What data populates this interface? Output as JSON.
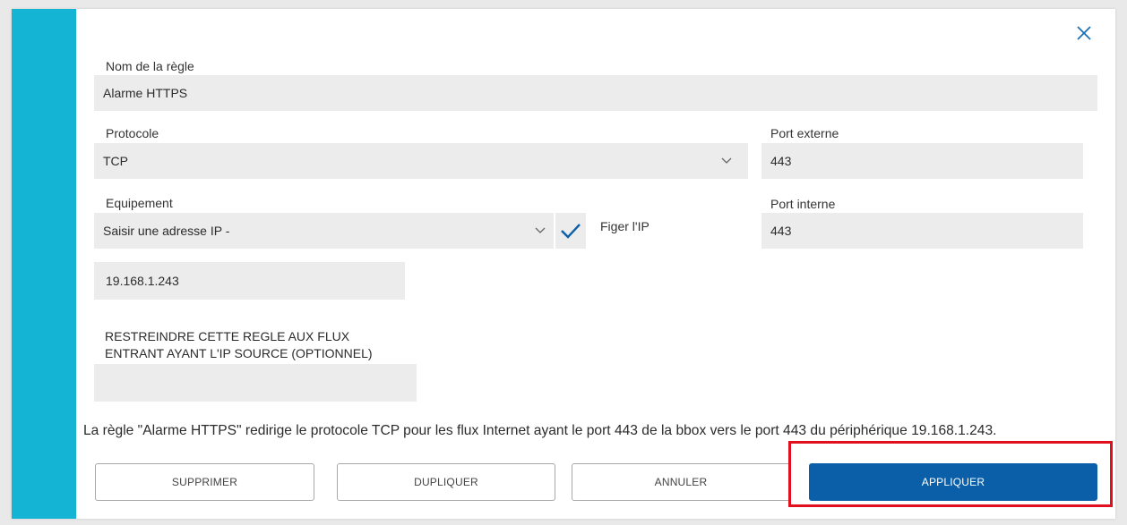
{
  "dialog": {
    "accent_color": "#14b4d4",
    "close_icon": "close-icon"
  },
  "rule_name": {
    "label": "Nom de la règle",
    "value": "Alarme HTTPS"
  },
  "protocol": {
    "label": "Protocole",
    "value": "TCP"
  },
  "external_port": {
    "label": "Port externe",
    "value": "443"
  },
  "equipment": {
    "label": "Equipement",
    "value": "Saisir une adresse IP -",
    "fix_ip_checked": true,
    "fix_ip_label": "Figer l'IP"
  },
  "internal_port": {
    "label": "Port interne",
    "value": "443"
  },
  "ip_address": {
    "value": "19.168.1.243"
  },
  "restrict": {
    "label_line1": "RESTREINDRE CETTE REGLE AUX FLUX",
    "label_line2": "ENTRANT AYANT L'IP SOURCE (OPTIONNEL)",
    "value": ""
  },
  "summary": "La règle \"Alarme HTTPS\" redirige le protocole TCP pour les flux Internet ayant le port 443 de la bbox vers le port 443 du périphérique 19.168.1.243.",
  "buttons": {
    "delete": "SUPPRIMER",
    "duplicate": "DUPLIQUER",
    "cancel": "ANNULER",
    "apply": "APPLIQUER"
  },
  "colors": {
    "primary": "#0a5fa8",
    "highlight": "#e0101e",
    "check": "#0a5fa8"
  }
}
